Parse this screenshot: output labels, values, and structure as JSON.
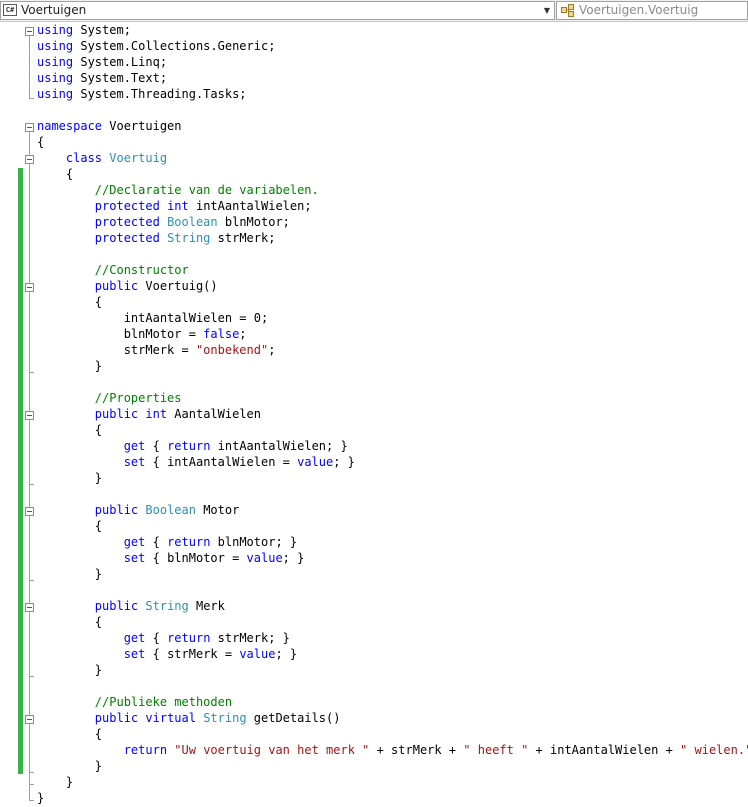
{
  "navigation": {
    "types_dropdown": {
      "value": "Voertuigen"
    },
    "members_dropdown": {
      "value": "Voertuigen.Voertuig"
    }
  },
  "colors": {
    "keyword": "#0000ff",
    "type": "#2b91af",
    "comment": "#008000",
    "string": "#a31515",
    "change_bar": "#38b34a"
  },
  "code": {
    "lines": [
      [
        [
          "kw",
          "using"
        ],
        [
          "p",
          " System;"
        ]
      ],
      [
        [
          "kw",
          "using"
        ],
        [
          "p",
          " System.Collections.Generic;"
        ]
      ],
      [
        [
          "kw",
          "using"
        ],
        [
          "p",
          " System.Linq;"
        ]
      ],
      [
        [
          "kw",
          "using"
        ],
        [
          "p",
          " System.Text;"
        ]
      ],
      [
        [
          "kw",
          "using"
        ],
        [
          "p",
          " System.Threading.Tasks;"
        ]
      ],
      [],
      [
        [
          "kw",
          "namespace"
        ],
        [
          "p",
          " Voertuigen"
        ]
      ],
      [
        [
          "p",
          "{"
        ]
      ],
      [
        [
          "p",
          "    "
        ],
        [
          "kw",
          "class"
        ],
        [
          "p",
          " "
        ],
        [
          "ty",
          "Voertuig"
        ]
      ],
      [
        [
          "p",
          "    {"
        ]
      ],
      [
        [
          "p",
          "        "
        ],
        [
          "cm",
          "//Declaratie van de variabelen."
        ]
      ],
      [
        [
          "p",
          "        "
        ],
        [
          "kw",
          "protected"
        ],
        [
          "p",
          " "
        ],
        [
          "kw",
          "int"
        ],
        [
          "p",
          " intAantalWielen;"
        ]
      ],
      [
        [
          "p",
          "        "
        ],
        [
          "kw",
          "protected"
        ],
        [
          "p",
          " "
        ],
        [
          "ty",
          "Boolean"
        ],
        [
          "p",
          " blnMotor;"
        ]
      ],
      [
        [
          "p",
          "        "
        ],
        [
          "kw",
          "protected"
        ],
        [
          "p",
          " "
        ],
        [
          "ty",
          "String"
        ],
        [
          "p",
          " strMerk;"
        ]
      ],
      [],
      [
        [
          "p",
          "        "
        ],
        [
          "cm",
          "//Constructor"
        ]
      ],
      [
        [
          "p",
          "        "
        ],
        [
          "kw",
          "public"
        ],
        [
          "p",
          " Voertuig()"
        ]
      ],
      [
        [
          "p",
          "        {"
        ]
      ],
      [
        [
          "p",
          "            intAantalWielen = 0;"
        ]
      ],
      [
        [
          "p",
          "            blnMotor = "
        ],
        [
          "kw",
          "false"
        ],
        [
          "p",
          ";"
        ]
      ],
      [
        [
          "p",
          "            strMerk = "
        ],
        [
          "st",
          "\"onbekend\""
        ],
        [
          "p",
          ";"
        ]
      ],
      [
        [
          "p",
          "        }"
        ]
      ],
      [],
      [
        [
          "p",
          "        "
        ],
        [
          "cm",
          "//Properties"
        ]
      ],
      [
        [
          "p",
          "        "
        ],
        [
          "kw",
          "public"
        ],
        [
          "p",
          " "
        ],
        [
          "kw",
          "int"
        ],
        [
          "p",
          " AantalWielen"
        ]
      ],
      [
        [
          "p",
          "        {"
        ]
      ],
      [
        [
          "p",
          "            "
        ],
        [
          "kw",
          "get"
        ],
        [
          "p",
          " { "
        ],
        [
          "kw",
          "return"
        ],
        [
          "p",
          " intAantalWielen; }"
        ]
      ],
      [
        [
          "p",
          "            "
        ],
        [
          "kw",
          "set"
        ],
        [
          "p",
          " { intAantalWielen = "
        ],
        [
          "kw",
          "value"
        ],
        [
          "p",
          "; }"
        ]
      ],
      [
        [
          "p",
          "        }"
        ]
      ],
      [],
      [
        [
          "p",
          "        "
        ],
        [
          "kw",
          "public"
        ],
        [
          "p",
          " "
        ],
        [
          "ty",
          "Boolean"
        ],
        [
          "p",
          " Motor"
        ]
      ],
      [
        [
          "p",
          "        {"
        ]
      ],
      [
        [
          "p",
          "            "
        ],
        [
          "kw",
          "get"
        ],
        [
          "p",
          " { "
        ],
        [
          "kw",
          "return"
        ],
        [
          "p",
          " blnMotor; }"
        ]
      ],
      [
        [
          "p",
          "            "
        ],
        [
          "kw",
          "set"
        ],
        [
          "p",
          " { blnMotor = "
        ],
        [
          "kw",
          "value"
        ],
        [
          "p",
          "; }"
        ]
      ],
      [
        [
          "p",
          "        }"
        ]
      ],
      [],
      [
        [
          "p",
          "        "
        ],
        [
          "kw",
          "public"
        ],
        [
          "p",
          " "
        ],
        [
          "ty",
          "String"
        ],
        [
          "p",
          " Merk"
        ]
      ],
      [
        [
          "p",
          "        {"
        ]
      ],
      [
        [
          "p",
          "            "
        ],
        [
          "kw",
          "get"
        ],
        [
          "p",
          " { "
        ],
        [
          "kw",
          "return"
        ],
        [
          "p",
          " strMerk; }"
        ]
      ],
      [
        [
          "p",
          "            "
        ],
        [
          "kw",
          "set"
        ],
        [
          "p",
          " { strMerk = "
        ],
        [
          "kw",
          "value"
        ],
        [
          "p",
          "; }"
        ]
      ],
      [
        [
          "p",
          "        }"
        ]
      ],
      [],
      [
        [
          "p",
          "        "
        ],
        [
          "cm",
          "//Publieke methoden"
        ]
      ],
      [
        [
          "p",
          "        "
        ],
        [
          "kw",
          "public"
        ],
        [
          "p",
          " "
        ],
        [
          "kw",
          "virtual"
        ],
        [
          "p",
          " "
        ],
        [
          "ty",
          "String"
        ],
        [
          "p",
          " getDetails()"
        ]
      ],
      [
        [
          "p",
          "        {"
        ]
      ],
      [
        [
          "p",
          "            "
        ],
        [
          "kw",
          "return"
        ],
        [
          "p",
          " "
        ],
        [
          "st",
          "\"Uw voertuig van het merk \""
        ],
        [
          "p",
          " + strMerk + "
        ],
        [
          "st",
          "\" heeft \""
        ],
        [
          "p",
          " + intAantalWielen + "
        ],
        [
          "st",
          "\" wielen.\""
        ],
        [
          "p",
          ";"
        ]
      ],
      [
        [
          "p",
          "        }"
        ]
      ],
      [
        [
          "p",
          "    }"
        ]
      ],
      [
        [
          "p",
          "}"
        ]
      ]
    ]
  }
}
